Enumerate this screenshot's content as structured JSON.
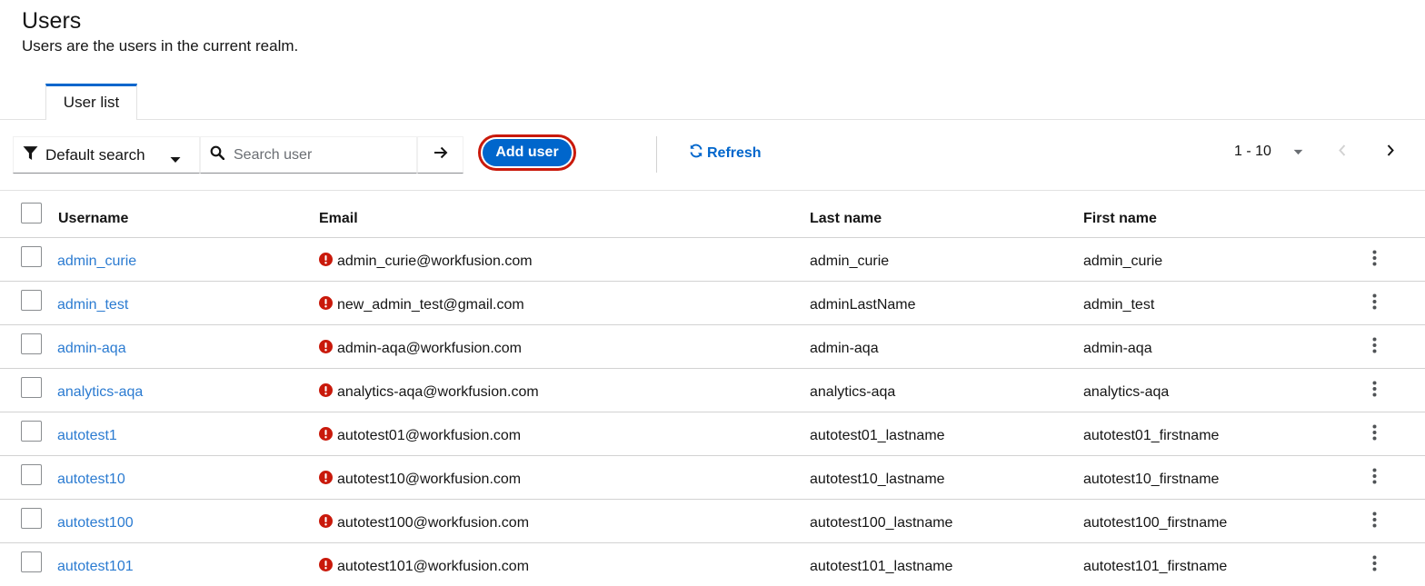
{
  "page": {
    "title": "Users",
    "subtitle": "Users are the users in the current realm."
  },
  "tabs": [
    {
      "label": "User list",
      "active": true
    }
  ],
  "toolbar": {
    "search_type": "Default search",
    "search_placeholder": "Search user",
    "search_value": "",
    "add_user_label": "Add user",
    "refresh_label": "Refresh",
    "pagination_label": "1 - 10"
  },
  "colors": {
    "accent": "#0066cc",
    "highlight_outline": "#c9190b",
    "warning": "#c9190b",
    "link": "#2b7bd1"
  },
  "table": {
    "headers": {
      "username": "Username",
      "email": "Email",
      "last_name": "Last name",
      "first_name": "First name"
    },
    "rows": [
      {
        "username": "admin_curie",
        "email": "admin_curie@workfusion.com",
        "last_name": "admin_curie",
        "first_name": "admin_curie"
      },
      {
        "username": "admin_test",
        "email": "new_admin_test@gmail.com",
        "last_name": "adminLastName",
        "first_name": "admin_test"
      },
      {
        "username": "admin-aqa",
        "email": "admin-aqa@workfusion.com",
        "last_name": "admin-aqa",
        "first_name": "admin-aqa"
      },
      {
        "username": "analytics-aqa",
        "email": "analytics-aqa@workfusion.com",
        "last_name": "analytics-aqa",
        "first_name": "analytics-aqa"
      },
      {
        "username": "autotest1",
        "email": "autotest01@workfusion.com",
        "last_name": "autotest01_lastname",
        "first_name": "autotest01_firstname"
      },
      {
        "username": "autotest10",
        "email": "autotest10@workfusion.com",
        "last_name": "autotest10_lastname",
        "first_name": "autotest10_firstname"
      },
      {
        "username": "autotest100",
        "email": "autotest100@workfusion.com",
        "last_name": "autotest100_lastname",
        "first_name": "autotest100_firstname"
      },
      {
        "username": "autotest101",
        "email": "autotest101@workfusion.com",
        "last_name": "autotest101_lastname",
        "first_name": "autotest101_firstname"
      }
    ]
  },
  "icons": {
    "filter": "filter-icon",
    "search": "search-icon",
    "go": "arrow-right-icon",
    "refresh": "refresh-icon",
    "warning": "exclamation-circle-icon",
    "kebab": "kebab-icon"
  }
}
